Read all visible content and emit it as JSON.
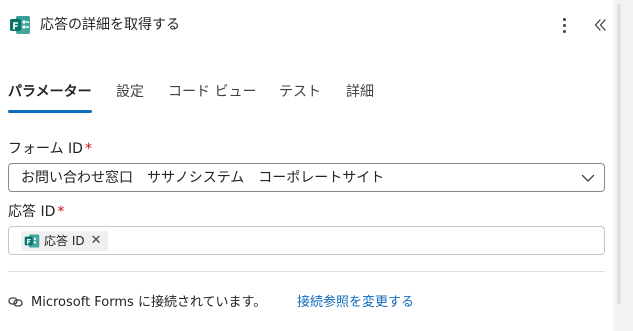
{
  "header": {
    "title": "応答の詳細を取得する",
    "app_icon": "forms-app-icon",
    "more_icon": "more-vertical-icon",
    "collapse_icon": "chevron-double-left-icon"
  },
  "tabs": [
    {
      "label": "パラメーター",
      "active": true
    },
    {
      "label": "設定",
      "active": false
    },
    {
      "label": "コード ビュー",
      "active": false
    },
    {
      "label": "テスト",
      "active": false
    },
    {
      "label": "詳細",
      "active": false
    }
  ],
  "form_id": {
    "label": "フォーム ID",
    "required_mark": "*",
    "value": "お問い合わせ窓口　ササノシステム　コーポレートサイト"
  },
  "response_id": {
    "label": "応答 ID",
    "required_mark": "*",
    "token_label": "応答 ID",
    "token_remove": "✕"
  },
  "connection": {
    "status_text": "Microsoft Forms に接続されています。",
    "change_link": "接続参照を変更する",
    "icon": "link-icon"
  },
  "colors": {
    "accent": "#0f6cbd",
    "required": "#c50f1f",
    "forms_brand": "#077568"
  }
}
